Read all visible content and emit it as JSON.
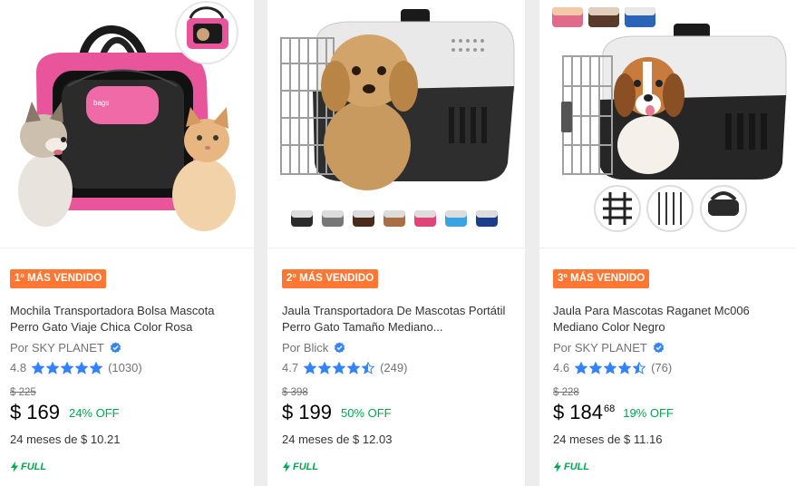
{
  "products": [
    {
      "badge": "1º MÁS VENDIDO",
      "title": "Mochila Transportadora Bolsa Mascota Perro Gato Viaje Chica Color Rosa",
      "seller": "Por SKY PLANET",
      "rating": "4.8",
      "stars": 5,
      "reviews": "(1030)",
      "old_price": "$ 225",
      "currency": "$",
      "price": "169",
      "cents": "",
      "discount": "24% OFF",
      "installments": "24 meses de $ 10.21",
      "shipping": "FULL"
    },
    {
      "badge": "2º MÁS VENDIDO",
      "title": "Jaula Transportadora De Mascotas Portátil Perro Gato Tamaño Mediano...",
      "seller": "Por Blick",
      "rating": "4.7",
      "stars": 4.5,
      "reviews": "(249)",
      "old_price": "$ 398",
      "currency": "$",
      "price": "199",
      "cents": "",
      "discount": "50% OFF",
      "installments": "24 meses de $ 12.03",
      "shipping": "FULL"
    },
    {
      "badge": "3º MÁS VENDIDO",
      "title": "Jaula Para Mascotas Raganet Mc006 Mediano Color Negro",
      "seller": "Por SKY PLANET",
      "rating": "4.6",
      "stars": 4.5,
      "reviews": "(76)",
      "old_price": "$ 228",
      "currency": "$",
      "price": "184",
      "cents": "68",
      "discount": "19% OFF",
      "installments": "24 meses de $ 11.16",
      "shipping": "FULL"
    }
  ],
  "colors": {
    "badge": "#ff7733",
    "discount": "#00a650",
    "star": "#3483fa",
    "verified": "#3483fa"
  }
}
